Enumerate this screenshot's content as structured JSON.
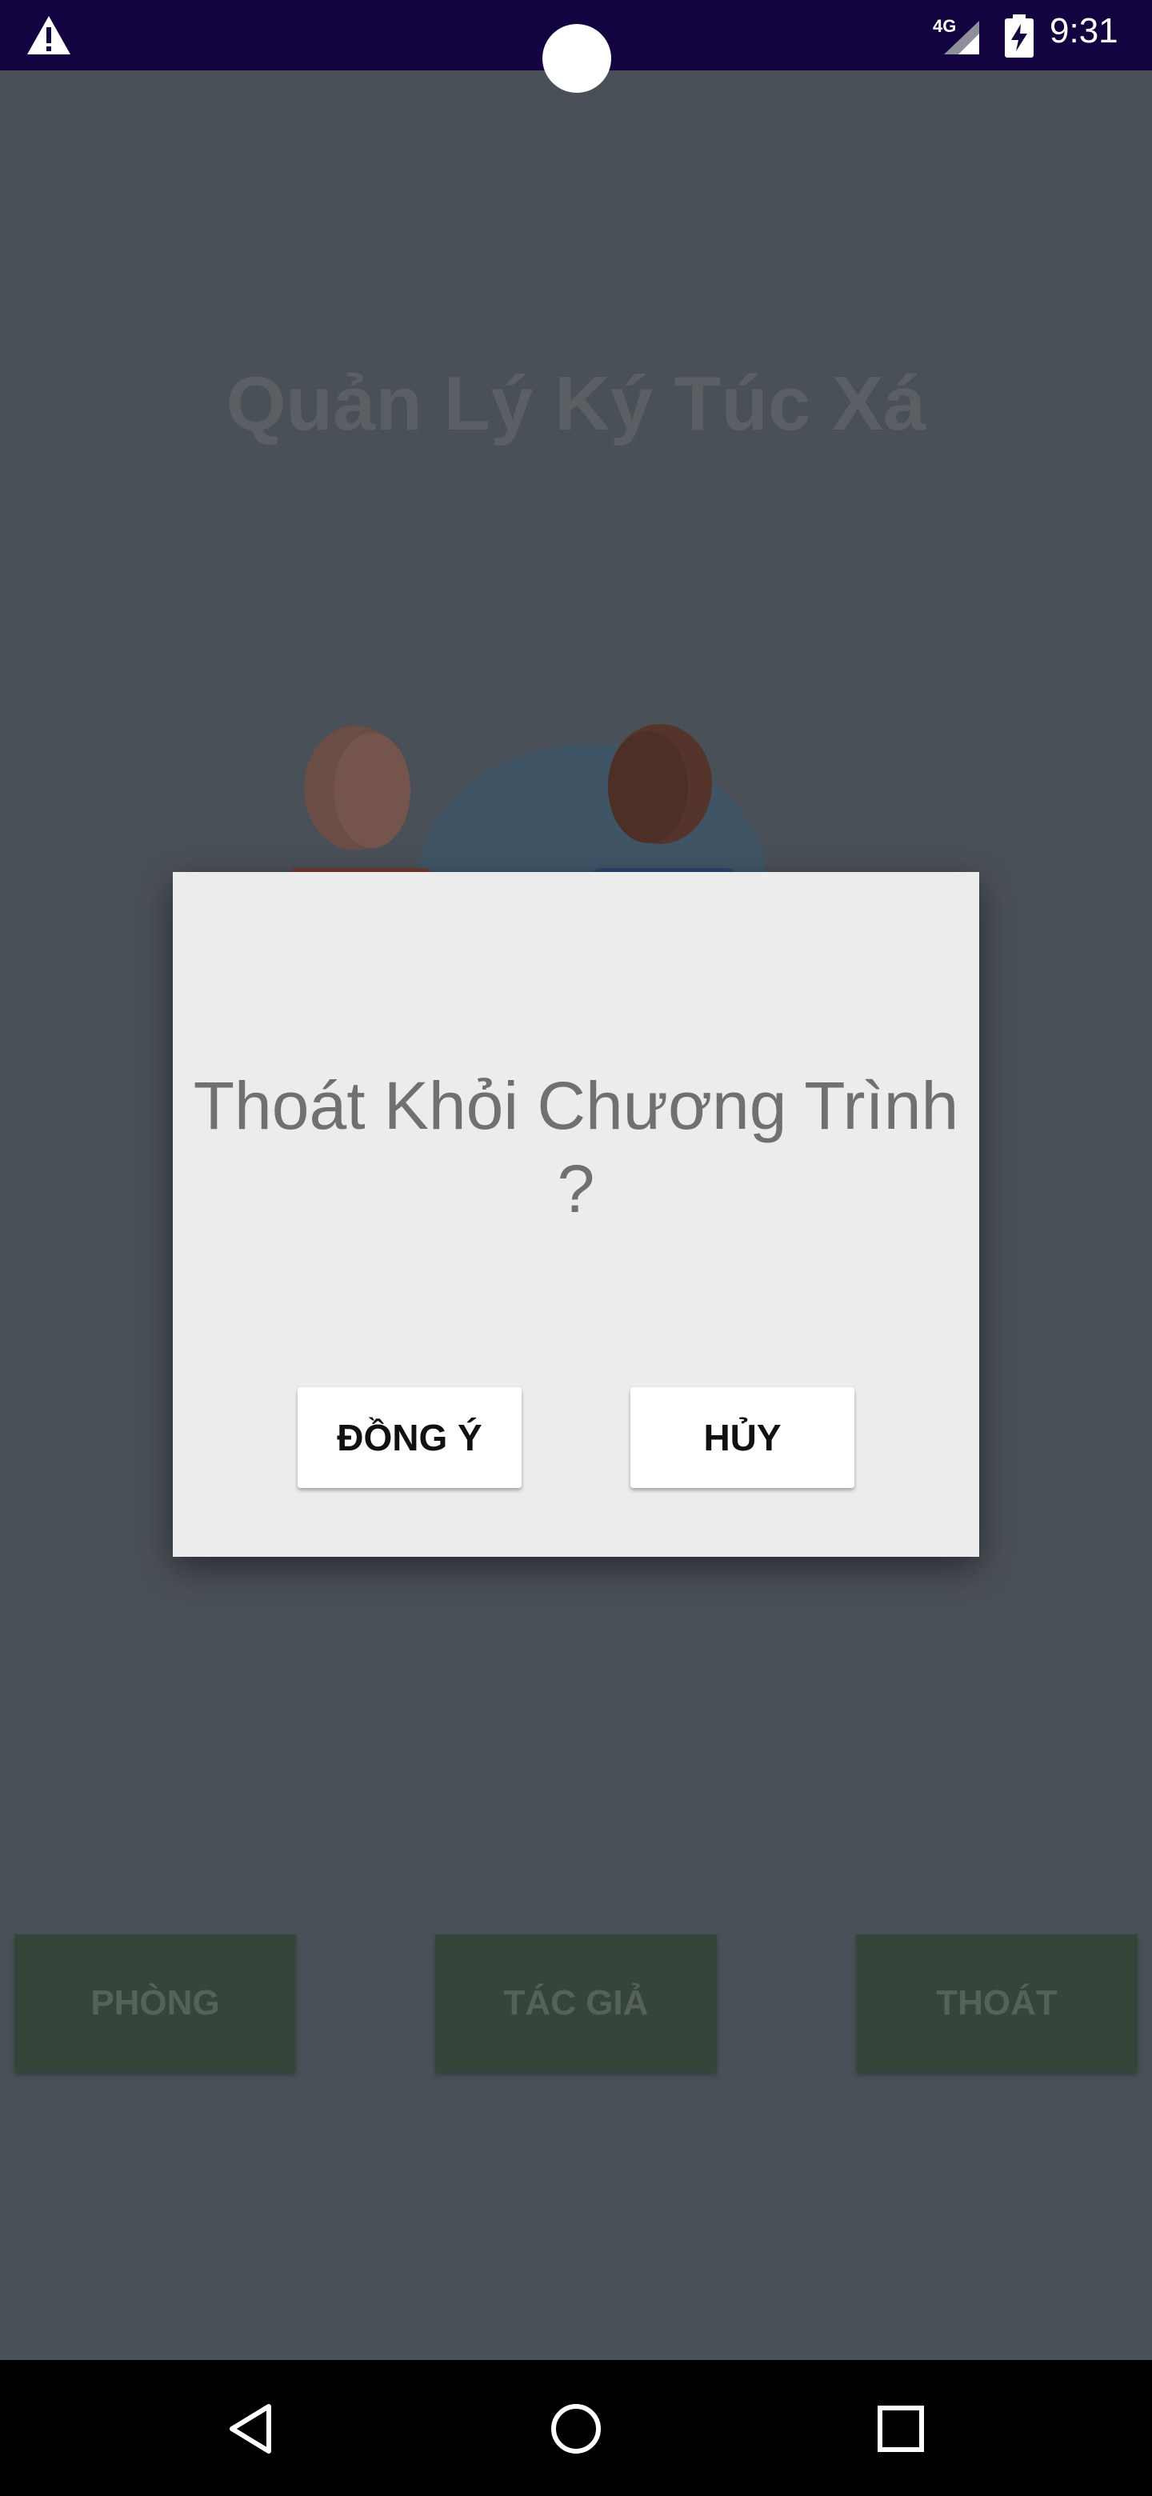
{
  "status_bar": {
    "network_type": "4G",
    "time": "9:31",
    "icons": [
      "warning-icon",
      "signal-icon",
      "battery-charging-icon"
    ]
  },
  "app": {
    "title": "Quản Lý Ký Túc Xá",
    "buttons": {
      "rooms": "PHÒNG",
      "author": "TÁC GIẢ",
      "exit": "THOÁT"
    }
  },
  "dialog": {
    "message": "Thoát Khỏi Chương Trình ?",
    "ok_label": "ĐỒNG Ý",
    "cancel_label": "HỦY"
  },
  "nav_bar": {
    "icons": [
      "back-icon",
      "home-icon",
      "recents-icon"
    ]
  },
  "colors": {
    "status_bar": "#130341",
    "scrim_background": "#4a5057",
    "dialog_background": "#ececec",
    "menu_button": "#36453a"
  }
}
